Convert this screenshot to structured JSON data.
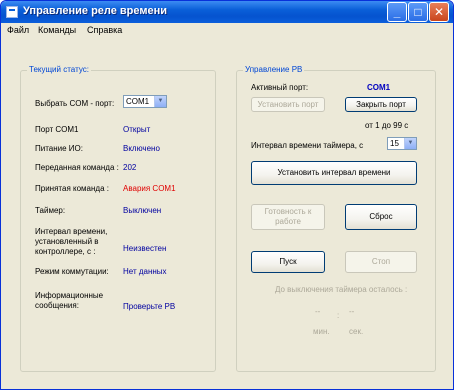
{
  "window": {
    "title": "Управление реле времени",
    "minimize": "_",
    "maximize": "□",
    "close": "✕"
  },
  "menu": [
    "Файл",
    "Команды",
    "Справка"
  ],
  "status": {
    "group_title": "Текущий статус:",
    "com_label": "Выбрать COM - порт:",
    "com_value": "COM1",
    "rows": [
      {
        "label": "Порт COM1",
        "value": "Открыт"
      },
      {
        "label": "Питание ИО:",
        "value": "Включено"
      },
      {
        "label": "Переданная команда :",
        "value": "202"
      },
      {
        "label": "Принятая команда :",
        "value": "Авария COM1"
      },
      {
        "label": "Таймер:",
        "value": "Выключен"
      },
      {
        "label": "Интервал времени, установленный в контроллере, с :",
        "value": "Неизвестен"
      },
      {
        "label": "Режим коммутации:",
        "value": "Нет данных"
      },
      {
        "label": "Информационные сообщения:",
        "value": "Проверьте РВ"
      }
    ]
  },
  "control": {
    "group_title": "Управление РВ",
    "active_port_label": "Активный порт:",
    "active_port_value": "COM1",
    "open_port_button": "Установить порт",
    "close_port_button": "Закрыть порт",
    "range_text": "от 1 до 99 с",
    "interval_label": "Интервал времени таймера, с",
    "interval_value": "15",
    "set_interval_button": "Установить интервал времени",
    "ready_button": "Готовность к работе",
    "reset_button": "Сброс",
    "start_button": "Пуск",
    "stop_button": "Стоп",
    "countdown_label": "До выключения таймера осталось :",
    "minutes_value": "--",
    "separator": ":",
    "seconds_value": "--",
    "minutes_unit": "мин.",
    "seconds_unit": "сек."
  }
}
